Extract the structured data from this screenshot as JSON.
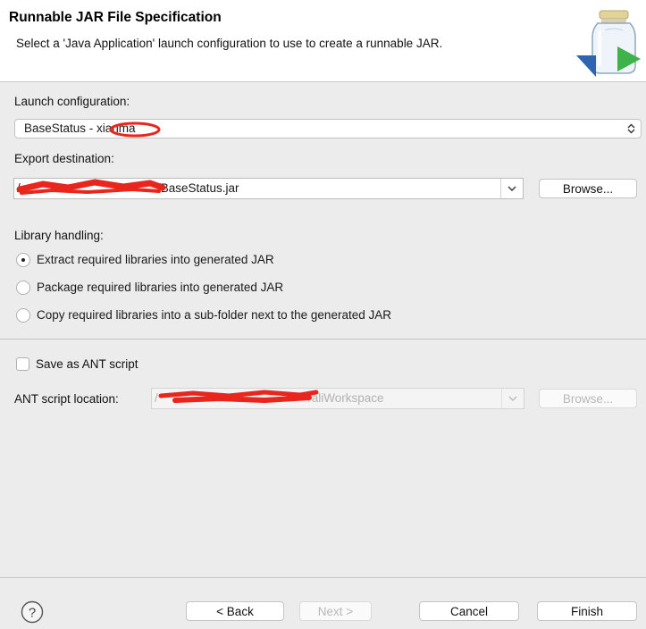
{
  "header": {
    "title": "Runnable JAR File Specification",
    "description": "Select a 'Java Application' launch configuration to use to create a runnable JAR."
  },
  "launch": {
    "label": "Launch configuration:",
    "value": "BaseStatus - xianma"
  },
  "export": {
    "label": "Export destination:",
    "path_visible": "/BaseStatus.jar",
    "browse_label": "Browse..."
  },
  "library": {
    "label": "Library handling:",
    "options": [
      "Extract required libraries into generated JAR",
      "Package required libraries into generated JAR",
      "Copy required libraries into a sub-folder next to the generated JAR"
    ],
    "selected_index": 0
  },
  "ant": {
    "save_label": "Save as ANT script",
    "save_checked": false,
    "location_label": "ANT script location:",
    "location_visible": "/aliWorkspace",
    "browse_label": "Browse..."
  },
  "footer": {
    "back_label": "< Back",
    "next_label": "Next >",
    "cancel_label": "Cancel",
    "finish_label": "Finish",
    "help_symbol": "?"
  },
  "colors": {
    "accent_green": "#3fb24a",
    "redaction_red": "#e8261e",
    "disabled_text": "#b2b2b2"
  },
  "icons": [
    "jar-export-icon",
    "chevron-up-down-icon",
    "chevron-down-icon",
    "help-icon"
  ]
}
